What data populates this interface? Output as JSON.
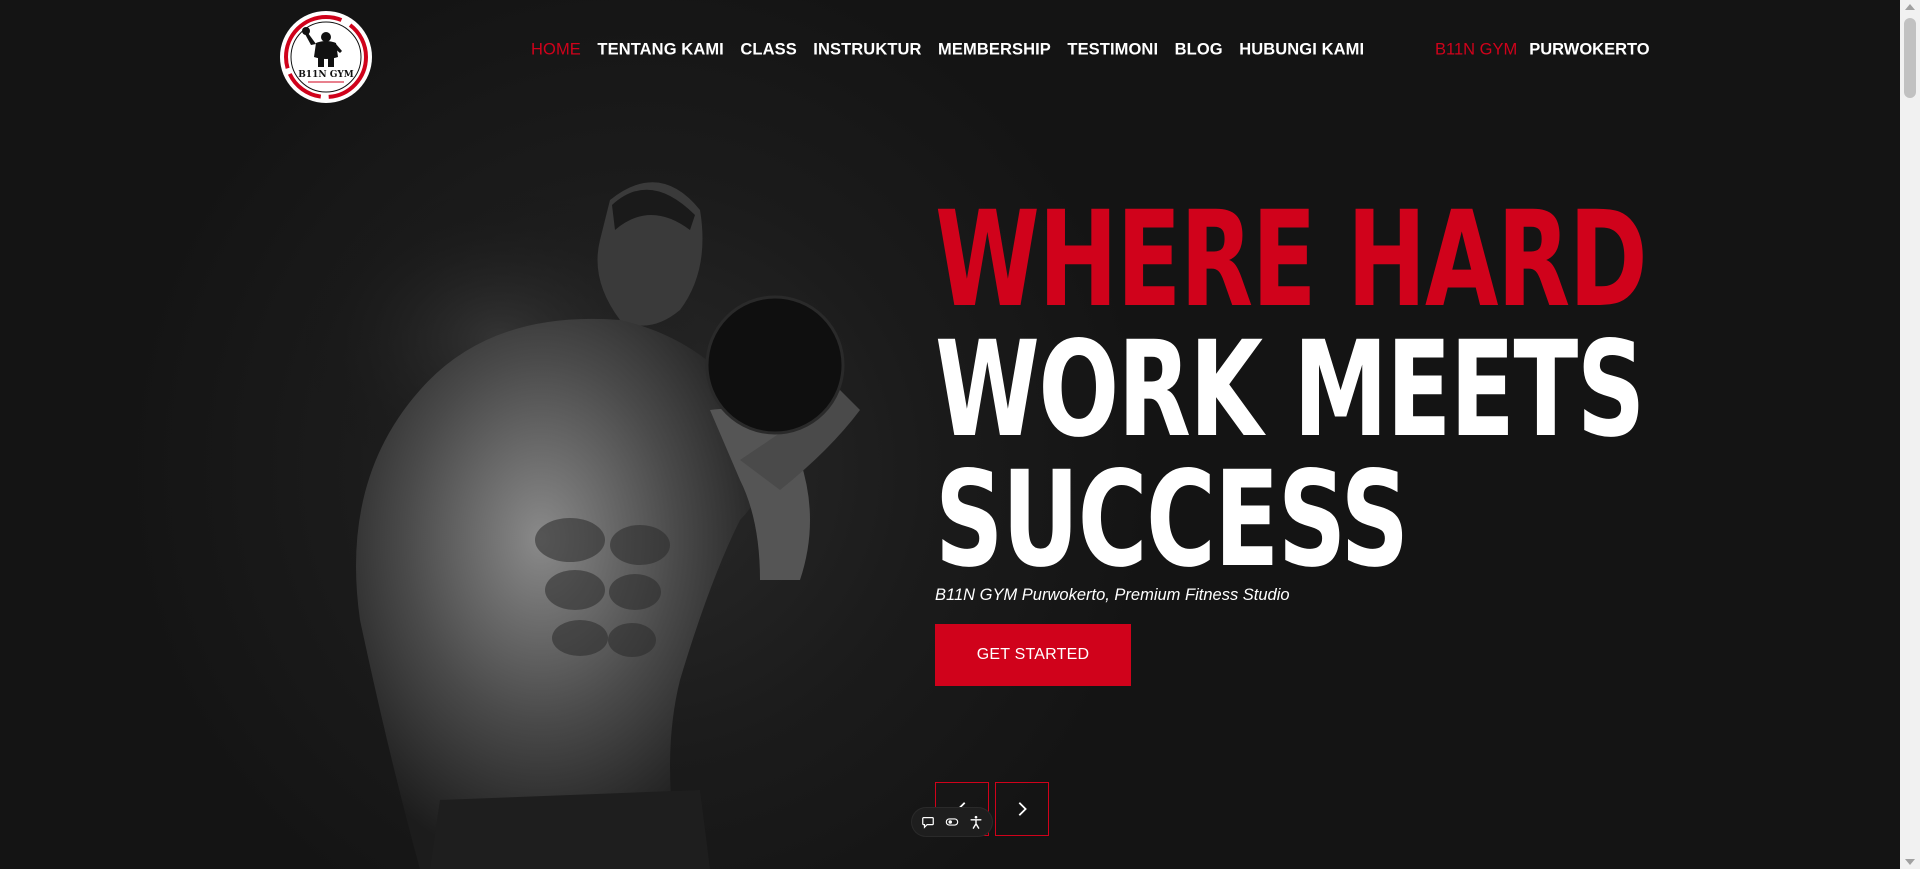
{
  "header": {
    "logo_text": "B11N GYM",
    "nav": [
      {
        "label": "HOME",
        "active": true
      },
      {
        "label": "TENTANG KAMI"
      },
      {
        "label": "CLASS"
      },
      {
        "label": "INSTRUKTUR"
      },
      {
        "label": "MEMBERSHIP"
      },
      {
        "label": "TESTIMONI"
      },
      {
        "label": "BLOG"
      },
      {
        "label": "HUBUNGI KAMI"
      }
    ],
    "brand_primary": "B11N GYM",
    "brand_secondary": "PURWOKERTO"
  },
  "hero": {
    "headline_line1": "WHERE HARD",
    "headline_line2": "WORK MEETS",
    "headline_line3": "SUCCESS",
    "subtitle": "B11N GYM Purwokerto, Premium Fitness Studio",
    "cta_label": "GET STARTED"
  },
  "icons": {
    "prev": "chevron-left-icon",
    "next": "chevron-right-icon",
    "a11y": [
      "chat-icon",
      "toggle-icon",
      "accessibility-icon"
    ]
  },
  "colors": {
    "accent": "#d0021b",
    "background": "#141414",
    "text": "#ffffff"
  }
}
